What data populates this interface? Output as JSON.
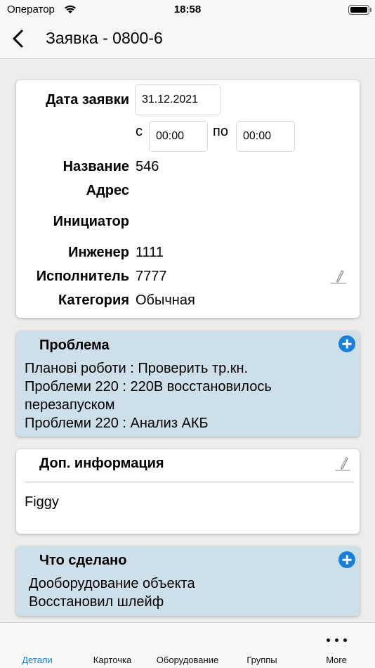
{
  "status_bar": {
    "carrier": "Оператор",
    "time": "18:58"
  },
  "nav": {
    "title": "Заявка - 0800-6"
  },
  "details": {
    "date_label": "Дата заявки",
    "date_value": "31.12.2021",
    "from_label": "с",
    "from_time": "00:00",
    "to_label": "по",
    "to_time": "00:00",
    "name_label": "Название",
    "name_value": "546",
    "address_label": "Адрес",
    "address_value": "",
    "initiator_label": "Инициатор",
    "initiator_value": "",
    "engineer_label": "Инженер",
    "engineer_value": "1111",
    "executor_label": "Исполнитель",
    "executor_value": "7777",
    "category_label": "Категория",
    "category_value": "Обычная"
  },
  "problem": {
    "title": "Проблема",
    "lines": [
      "Планові роботи : Проверить тр.кн.",
      "Проблеми 220 : 220В восстановилось перезапуском",
      "Проблеми 220 : Анализ АКБ"
    ]
  },
  "extra_info": {
    "title": "Доп. информация",
    "text": "Figgy"
  },
  "done": {
    "title": "Что сделано",
    "lines": [
      "Дооборудование объекта",
      "Восстановил шлейф"
    ]
  },
  "tabs": [
    {
      "label": "Детали",
      "active": true
    },
    {
      "label": "Карточка",
      "active": false
    },
    {
      "label": "Оборудование",
      "active": false
    },
    {
      "label": "Группы",
      "active": false
    },
    {
      "label": "More",
      "active": false
    }
  ],
  "colors": {
    "accent": "#1a7fd6",
    "blue_card": "#cde0ea",
    "background": "#efedeb"
  }
}
